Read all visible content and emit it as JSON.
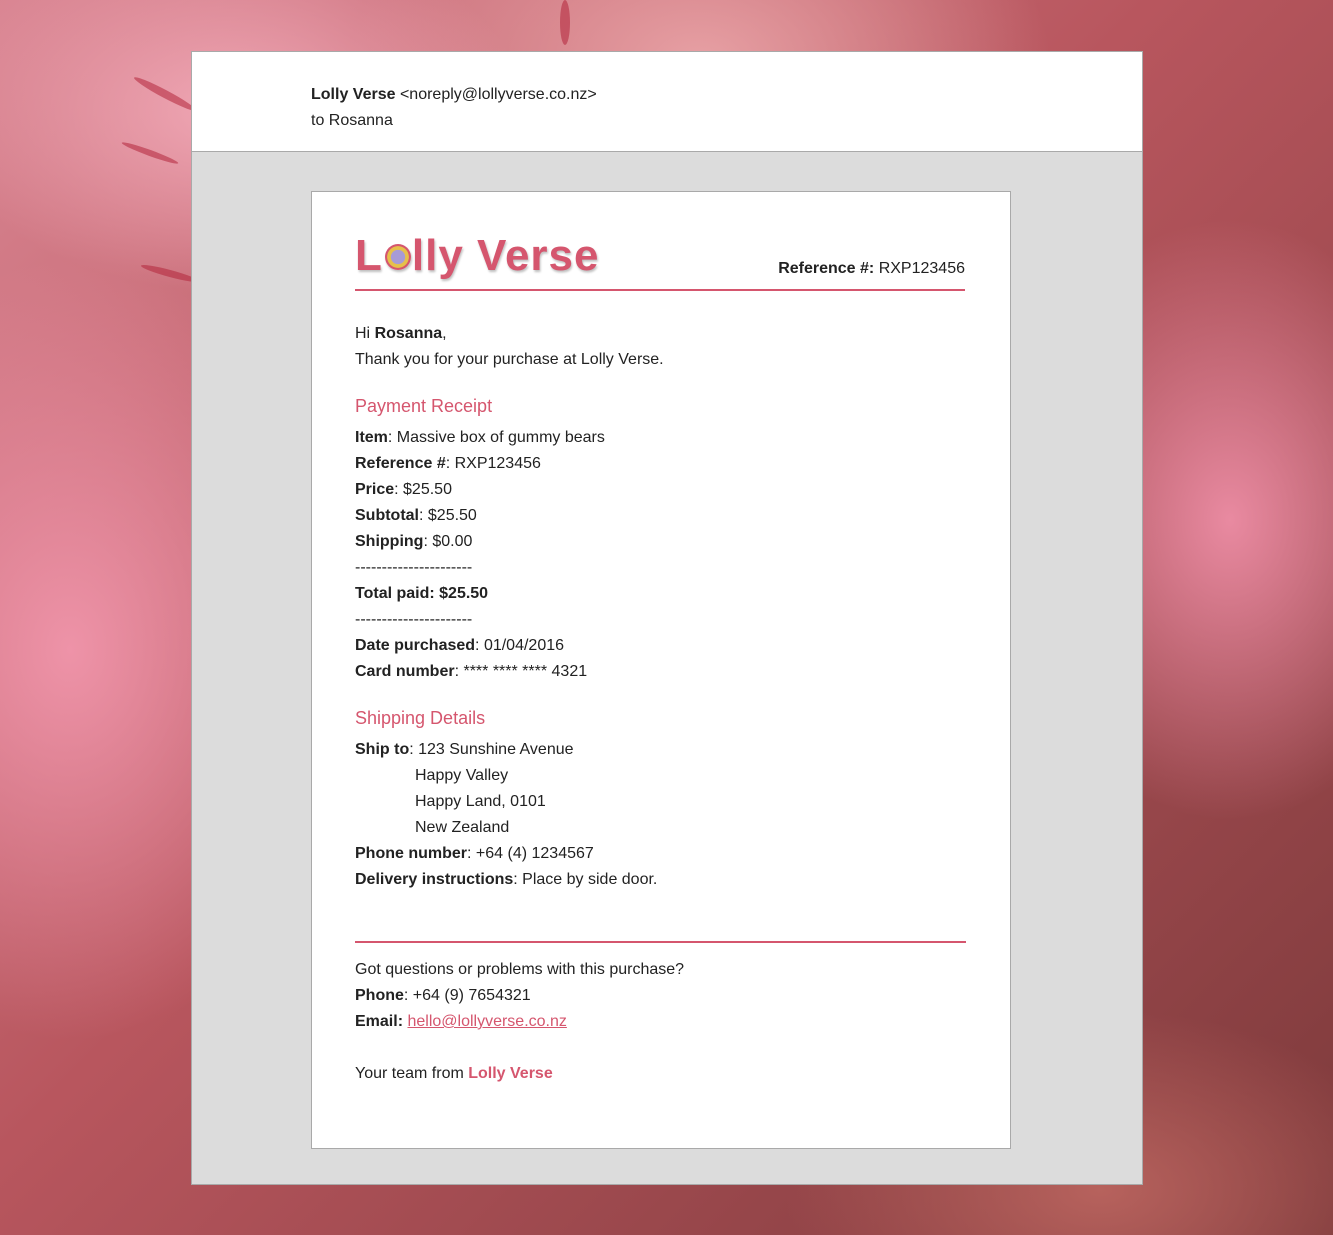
{
  "header": {
    "sender_name": "Lolly Verse",
    "sender_email": "<noreply@lollyverse.co.nz>",
    "to_line": "to Rosanna"
  },
  "brand": {
    "logo_part1": "L",
    "logo_part2": "lly Verse",
    "accent_color": "#d5566e"
  },
  "reference": {
    "label": "Reference #:",
    "value": "RXP123456"
  },
  "greeting": {
    "hi": "Hi ",
    "name": "Rosanna",
    "comma": ",",
    "thanks": "Thank you for your purchase at Lolly Verse."
  },
  "payment": {
    "title": "Payment Receipt",
    "item_label": "Item",
    "item_value": ": Massive box of gummy bears",
    "ref_label": "Reference #",
    "ref_value": ": RXP123456",
    "price_label": "Price",
    "price_value": ": $25.50",
    "subtotal_label": "Subtotal",
    "subtotal_value": ": $25.50",
    "shipping_label": "Shipping",
    "shipping_value": ": $0.00",
    "dashes": "----------------------",
    "total_label": "Total paid: $25.50",
    "date_label": "Date purchased",
    "date_value": ": 01/04/2016",
    "card_label": "Card number",
    "card_value": ": **** **** **** 4321"
  },
  "shipping": {
    "title": "Shipping Details",
    "shipto_label": "Ship to",
    "shipto_value": ": 123 Sunshine Avenue",
    "address": [
      "Happy Valley",
      "Happy Land, 0101",
      "New Zealand"
    ],
    "phone_label": "Phone number",
    "phone_value": ": +64 (4) 1234567",
    "delivery_label": "Delivery instructions",
    "delivery_value": ": Place by side door."
  },
  "footer": {
    "question": "Got questions or problems with this purchase?",
    "phone_label": "Phone",
    "phone_value": ": +64 (9) 7654321",
    "email_label": "Email:",
    "email_link": "hello@lollyverse.co.nz",
    "signoff": "Your team from ",
    "signoff_brand": "Lolly Verse"
  }
}
